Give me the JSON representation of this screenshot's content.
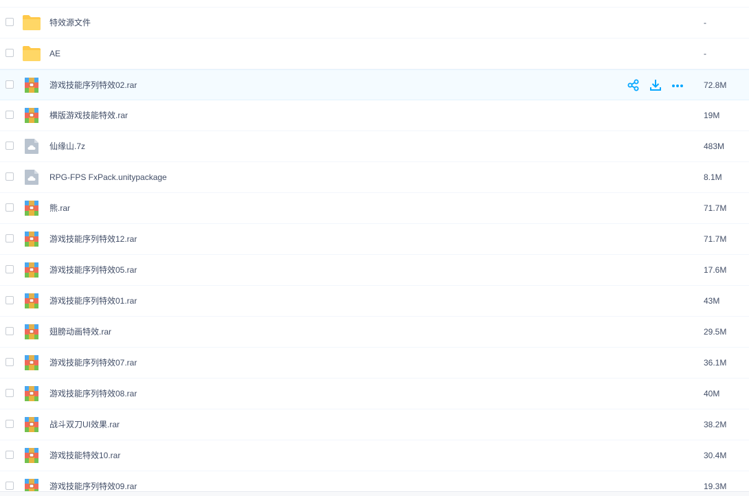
{
  "files": [
    {
      "name": "特效源文件",
      "size": "-",
      "type": "folder",
      "icon": "folder-icon"
    },
    {
      "name": "AE",
      "size": "-",
      "type": "folder",
      "icon": "folder-icon"
    },
    {
      "name": "游戏技能序列特效02.rar",
      "size": "72.8M",
      "type": "rar",
      "icon": "rar-archive-icon",
      "hover": true
    },
    {
      "name": "横版游戏技能特效.rar",
      "size": "19M",
      "type": "rar",
      "icon": "rar-archive-icon"
    },
    {
      "name": "仙缘山.7z",
      "size": "483M",
      "type": "cloud",
      "icon": "cloud-file-icon"
    },
    {
      "name": "RPG-FPS FxPack.unitypackage",
      "size": "8.1M",
      "type": "cloud",
      "icon": "cloud-file-icon"
    },
    {
      "name": "熊.rar",
      "size": "71.7M",
      "type": "rar",
      "icon": "rar-archive-icon"
    },
    {
      "name": "游戏技能序列特效12.rar",
      "size": "71.7M",
      "type": "rar",
      "icon": "rar-archive-icon"
    },
    {
      "name": "游戏技能序列特效05.rar",
      "size": "17.6M",
      "type": "rar",
      "icon": "rar-archive-icon"
    },
    {
      "name": "游戏技能序列特效01.rar",
      "size": "43M",
      "type": "rar",
      "icon": "rar-archive-icon"
    },
    {
      "name": "翅膀动画特效.rar",
      "size": "29.5M",
      "type": "rar",
      "icon": "rar-archive-icon"
    },
    {
      "name": "游戏技能序列特效07.rar",
      "size": "36.1M",
      "type": "rar",
      "icon": "rar-archive-icon"
    },
    {
      "name": "游戏技能序列特效08.rar",
      "size": "40M",
      "type": "rar",
      "icon": "rar-archive-icon"
    },
    {
      "name": "战斗双刀UI效果.rar",
      "size": "38.2M",
      "type": "rar",
      "icon": "rar-archive-icon"
    },
    {
      "name": "游戏技能特效10.rar",
      "size": "30.4M",
      "type": "rar",
      "icon": "rar-archive-icon"
    },
    {
      "name": "游戏技能序列特效09.rar",
      "size": "19.3M",
      "type": "rar",
      "icon": "rar-archive-icon"
    }
  ],
  "row_actions": [
    {
      "name": "share-icon"
    },
    {
      "name": "download-icon"
    },
    {
      "name": "more-icon"
    }
  ],
  "colors": {
    "accent": "#06a7ff",
    "text": "#424e67",
    "folder": "#ffd766",
    "hover_bg": "#f4fbff"
  }
}
